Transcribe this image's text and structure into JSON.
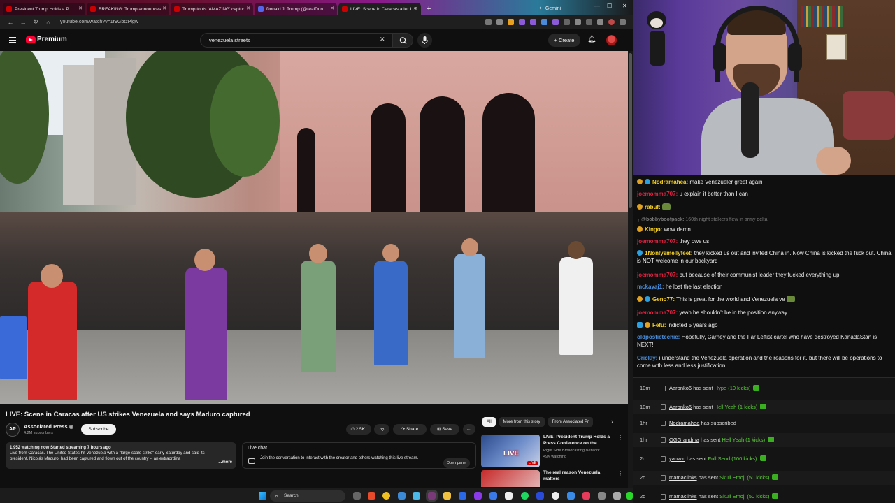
{
  "browser": {
    "tabs": [
      {
        "label": "President Trump Holds a P",
        "color": "#cc0000"
      },
      {
        "label": "BREAKING: Trump announces",
        "color": "#cc0000"
      },
      {
        "label": "Trump touts 'AMAZING' captur",
        "color": "#cc0000"
      },
      {
        "label": "Donald J. Trump (@realDon",
        "color": "#5566ee"
      },
      {
        "label": "LIVE: Scene in Caracas after US",
        "color": "#cc0000"
      }
    ],
    "extra_tab": "Gemini",
    "url": "youtube.com/watch?v=1r9GbtzPigw"
  },
  "youtube": {
    "logo_text": "Premium",
    "search_value": "venezuela streets",
    "create_label": "Create",
    "video_title": "LIVE: Scene in Caracas after US strikes Venezuela and says Maduro captured",
    "channel": {
      "avatar_text": "AP",
      "name": "Associated Press",
      "subscribers": "4.2M subscribers",
      "subscribe_label": "Subscribe"
    },
    "actions": {
      "likes": "2.5K",
      "share": "Share",
      "save": "Save"
    },
    "description": {
      "meta": "1,952 watching now  Started streaming 7 hours ago",
      "text": "Live from Caracas. The United States hit Venezuela with a \"large-scale strike\" early Saturday and said its president, Nicolás Maduro, had been captured and flown out of the country -- an extraordina",
      "more": "...more"
    },
    "live_chat": {
      "title": "Live chat",
      "text": "Join the conversation to interact with the creator and others watching this live stream.",
      "button": "Open panel"
    },
    "filters": [
      "All",
      "More from this story",
      "From Associated Pr"
    ],
    "recommendations": [
      {
        "title": "LIVE: President Trump Holds a Press Conference on the ...",
        "channel": "Right Side Broadcasting Network",
        "views": "49K watching",
        "thumb_label": "LIVE",
        "tag": "LIVE"
      },
      {
        "title": "The real reason Venezuela matters",
        "channel": "",
        "views": "",
        "thumb_label": "",
        "tag": ""
      }
    ]
  },
  "taskbar": {
    "search_label": "Search"
  },
  "chat": {
    "messages": [
      {
        "user": "Nodramahea:",
        "text": "make Venezueler great again",
        "user_color": "#f5d020",
        "badge_color": "#2aa0e0"
      },
      {
        "user": "joemomma707:",
        "text": "u explain it better than I can",
        "user_color": "#e02040",
        "badge_color": ""
      },
      {
        "user": "rabuf:",
        "text": "",
        "user_color": "#f5d020",
        "badge_color": "#2aa0e0"
      },
      {
        "user": "@bobbyboofpack:",
        "text": "160th night stalkers flew in army delta",
        "user_color": "#aaaaaa",
        "badge_color": "",
        "faded": true
      },
      {
        "user": "Kingo:",
        "text": "wow damn",
        "user_color": "#f5d020",
        "badge_color": "#e0a020"
      },
      {
        "user": "joemomma707:",
        "text": "they owe us",
        "user_color": "#e02040",
        "badge_color": ""
      },
      {
        "user": "1Nonlysmellyfeet:",
        "text": "they kicked us out and invited China in. Now China is kicked the fuck out. China is NOT welcome in our backyard",
        "user_color": "#f5d020",
        "badge_color": "#2aa0e0"
      },
      {
        "user": "joemomma707:",
        "text": "but because of their communist leader they fucked everything up",
        "user_color": "#e02040",
        "badge_color": ""
      },
      {
        "user": "mckayaj1:",
        "text": "he lost the last election",
        "user_color": "#4a90e0",
        "badge_color": ""
      },
      {
        "user": "Geno77:",
        "text": "This is great for the world and Venezuela ve",
        "user_color": "#f5d020",
        "badge_color": "#2aa0e0"
      },
      {
        "user": "joemomma707:",
        "text": "yeah he shouldn't be in the position anyway",
        "user_color": "#e02040",
        "badge_color": ""
      },
      {
        "user": "Fefu:",
        "text": "indicted 5 years ago",
        "user_color": "#f5d020",
        "badge_color": "#2aa0e0"
      },
      {
        "user": "oldpostietechie:",
        "text": "Hopefully, Carney and the Far Leftist cartel who have destroyed KanadaStan is NEXT!",
        "user_color": "#4a90e0",
        "badge_color": ""
      },
      {
        "user": "Crickly:",
        "text": "i understand the Venezuela operation and the reasons for it, but there will be operations to come with less and less justification",
        "user_color": "#4a90e0",
        "badge_color": ""
      }
    ]
  },
  "events": [
    {
      "time": "10m",
      "who": "Aaronko6",
      "verb": "has sent",
      "what": "Hype (10 kicks)"
    },
    {
      "time": "10m",
      "who": "Aaronko6",
      "verb": "has sent",
      "what": "Hell Yeah (1 kicks)"
    },
    {
      "time": "1hr",
      "who": "Nodramahea",
      "verb": "has subscribed",
      "what": ""
    },
    {
      "time": "1hr",
      "who": "OGGrandma",
      "verb": "has sent",
      "what": "Hell Yeah (1 kicks)"
    },
    {
      "time": "2d",
      "who": "yanwic",
      "verb": "has sent",
      "what": "Full Send (100 kicks)"
    },
    {
      "time": "2d",
      "who": "mamaclinks",
      "verb": "has sent",
      "what": "Skull Emoji (50 kicks)"
    },
    {
      "time": "2d",
      "who": "mamaclinks",
      "verb": "has sent",
      "what": "Skull Emoji (50 kicks)"
    }
  ]
}
